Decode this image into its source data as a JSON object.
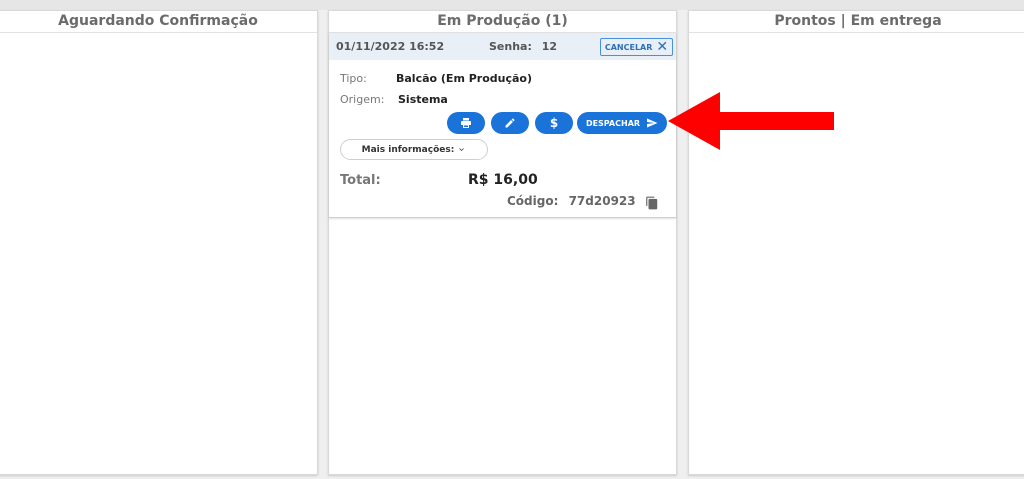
{
  "columns": [
    {
      "title": "Aguardando Confirmação"
    },
    {
      "title": "Em Produção (1)"
    },
    {
      "title": "Prontos | Em entrega"
    }
  ],
  "order": {
    "datetime": "01/11/2022 16:52",
    "senha_label": "Senha:",
    "senha_value": "12",
    "cancel_label": "CANCELAR",
    "tipo_label": "Tipo:",
    "tipo_value": "Balcão (Em Produção)",
    "origem_label": "Origem:",
    "origem_value": "Sistema",
    "dispatch_label": "DESPACHAR",
    "more_info_label": "Mais informações:",
    "total_label": "Total:",
    "total_value": "R$ 16,00",
    "codigo_label": "Código:",
    "codigo_value": "77d20923"
  },
  "icons": [
    "printer-icon",
    "pencil-icon",
    "dollar-icon",
    "send-icon",
    "close-icon",
    "chevron-down-icon",
    "copy-icon",
    "red-arrow-annotation"
  ],
  "colors": {
    "primary": "#1a73d9",
    "card_header": "#e9eff6",
    "annotation": "#ff0000"
  }
}
